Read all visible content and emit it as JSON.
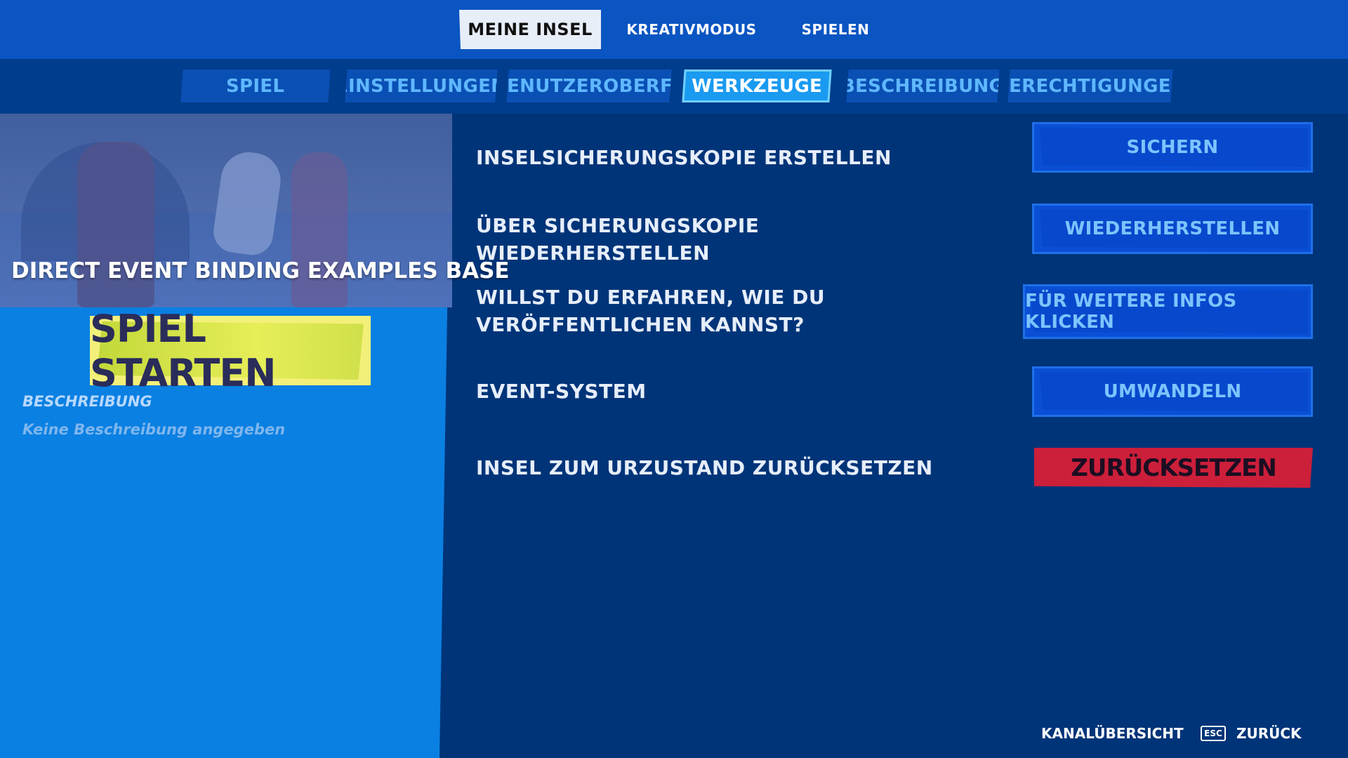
{
  "top_tabs": [
    {
      "label": "MEINE INSEL",
      "active": true
    },
    {
      "label": "KREATIVMODUS",
      "active": false
    },
    {
      "label": "SPIELEN",
      "active": false
    }
  ],
  "sub_tabs": [
    {
      "label": "SPIEL"
    },
    {
      "label": "EINSTELLUNGEN"
    },
    {
      "label": "BENUTZEROBERFL"
    },
    {
      "label": "WERKZEUGE",
      "active": true
    },
    {
      "label": "BESCHREIBUNG"
    },
    {
      "label": "BERECHTIGUNGEN"
    }
  ],
  "island": {
    "title": "DIRECT EVENT BINDING EXAMPLES BASE",
    "start_button": "SPIEL STARTEN",
    "description_label": "BESCHREIBUNG",
    "description_text": "Keine Beschreibung angegeben"
  },
  "tools": [
    {
      "label": "INSELSICHERUNGSKOPIE ERSTELLEN",
      "button": "SICHERN"
    },
    {
      "label": "ÜBER SICHERUNGSKOPIE\nWIEDERHERSTELLEN",
      "button": "WIEDERHERSTELLEN"
    },
    {
      "label": "WILLST DU ERFAHREN, WIE DU\nVERÖFFENTLICHEN KANNST?",
      "button": "FÜR WEITERE INFOS KLICKEN"
    },
    {
      "label": "EVENT-SYSTEM",
      "button": "UMWANDELN"
    },
    {
      "label": "INSEL ZUM URZUSTAND ZURÜCKSETZEN",
      "button": "ZURÜCKSETZEN"
    }
  ],
  "footer": {
    "channel_overview": "KANALÜBERSICHT",
    "esc_key": "ESC",
    "back": "ZURÜCK"
  },
  "colors": {
    "background": "#003478",
    "topbar": "#0a55c2",
    "left_panel": "#0a80e2",
    "start_button": "#e6ee58",
    "reset_button": "#cc1f3a",
    "action_button_text": "#7cc4ff"
  }
}
